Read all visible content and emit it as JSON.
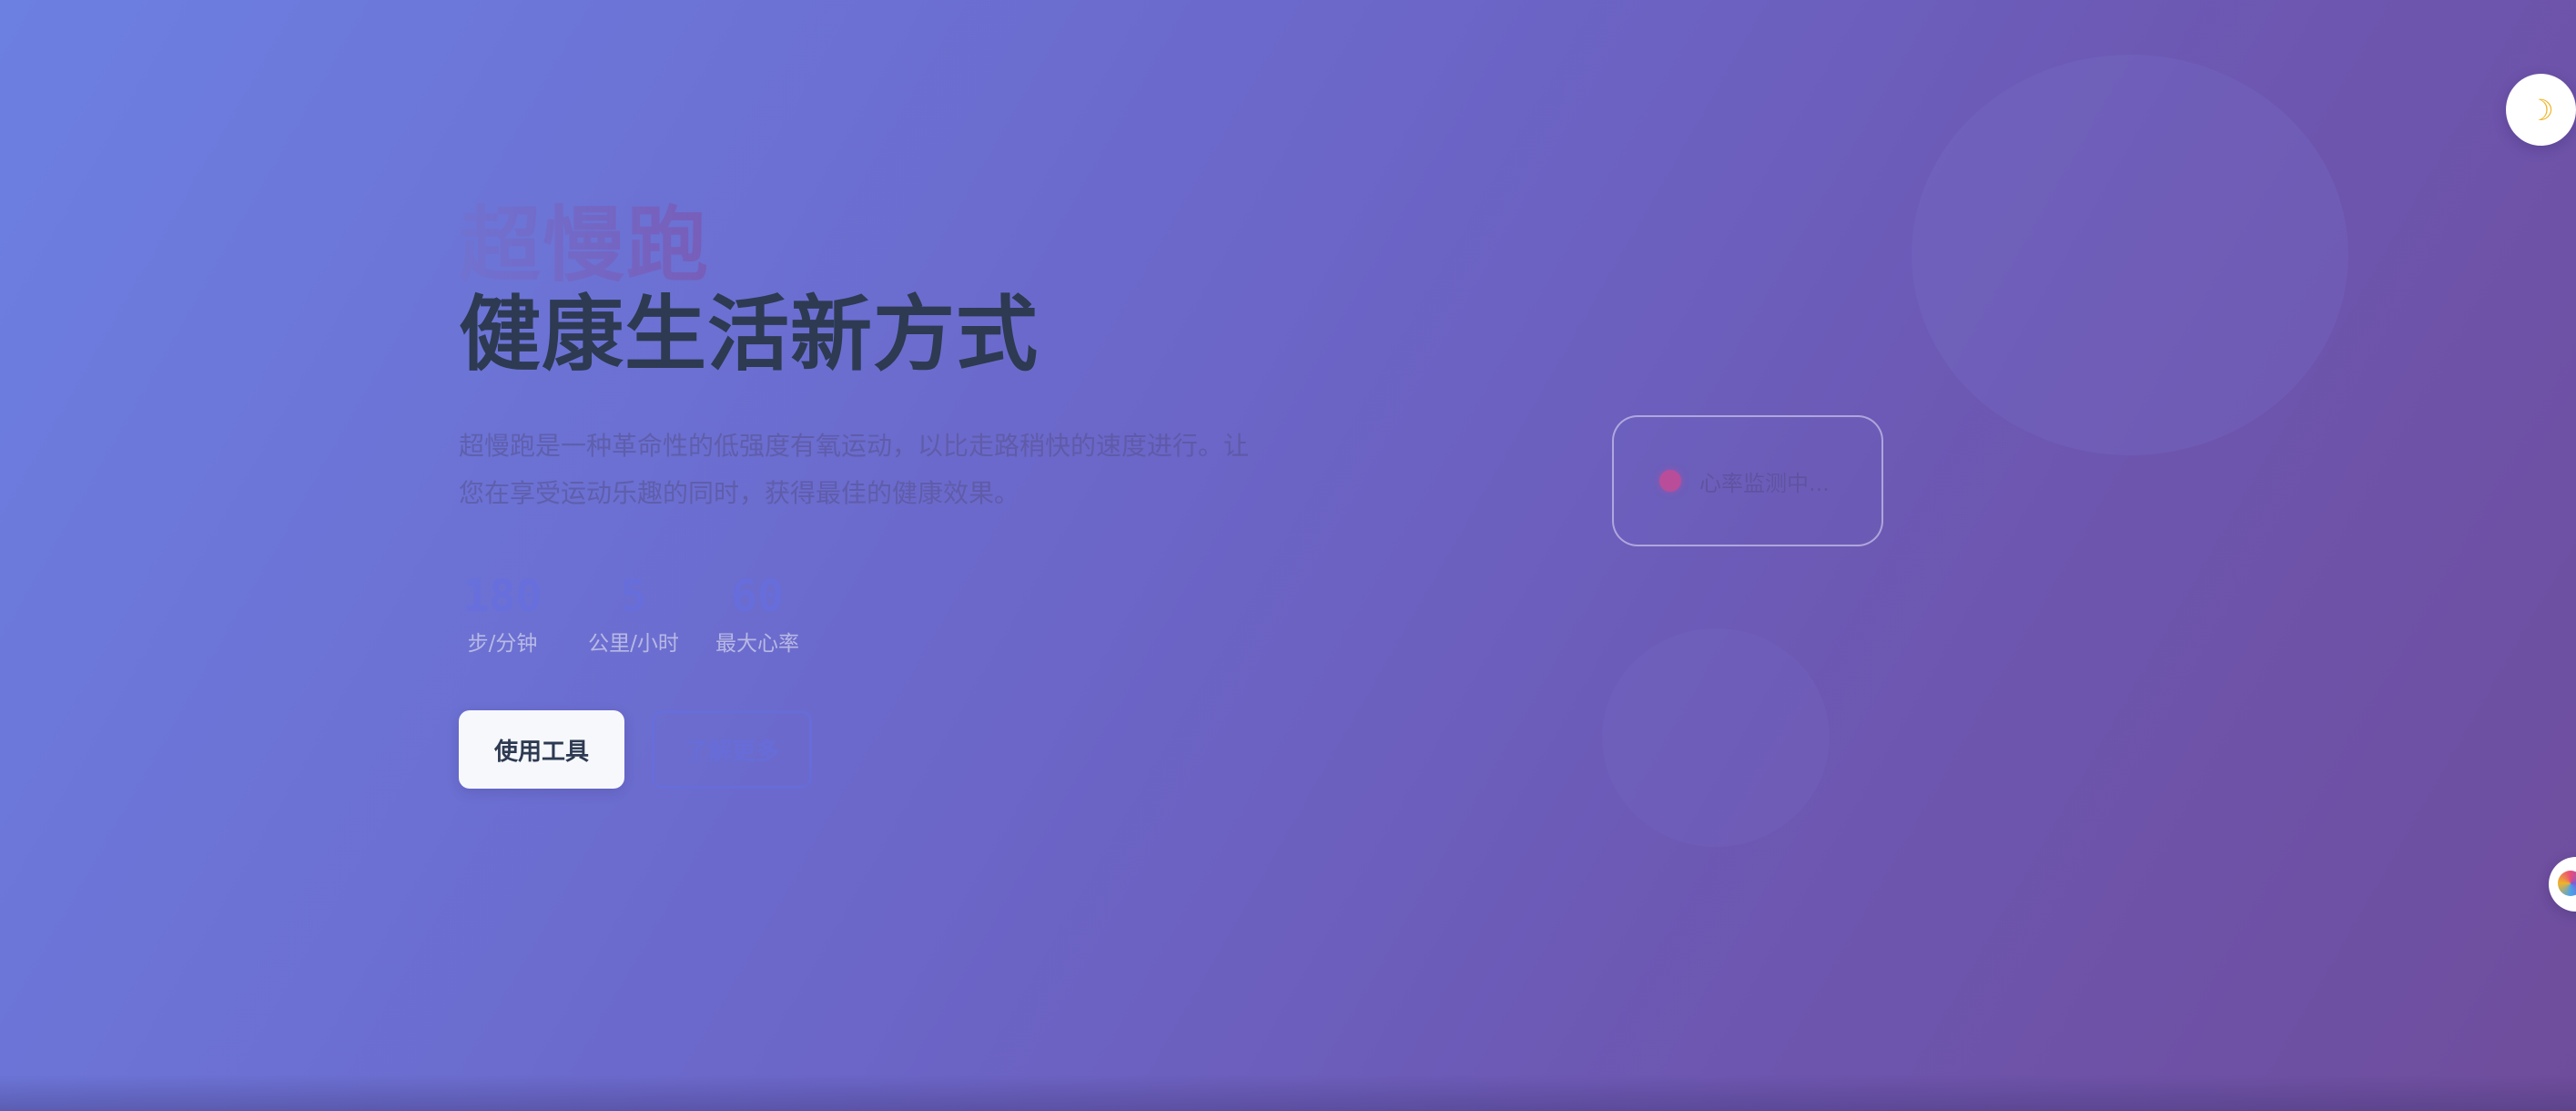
{
  "hero": {
    "title_main": "超慢跑",
    "title_sub": "健康生活新方式",
    "description": "超慢跑是一种革命性的低强度有氧运动，以比走路稍快的速度进行。让您在享受运动乐趣的同时，获得最佳的健康效果。"
  },
  "stats": [
    {
      "value": "180",
      "label": "步/分钟"
    },
    {
      "value": "5",
      "label": "公里/小时"
    },
    {
      "value": "60",
      "label": "最大心率"
    }
  ],
  "buttons": {
    "primary_label": "使用工具",
    "secondary_label": "了解更多"
  },
  "monitor": {
    "status_text": "心率监测中..."
  },
  "icons": {
    "theme_toggle": "moon-icon",
    "side_fab": "globe-icon"
  },
  "colors": {
    "gradient_start": "#6c80e2",
    "gradient_end": "#6f4d9c",
    "title_dark": "#2d3a52",
    "pulse": "#b94d9a",
    "button_bg": "#f7f8fb"
  }
}
